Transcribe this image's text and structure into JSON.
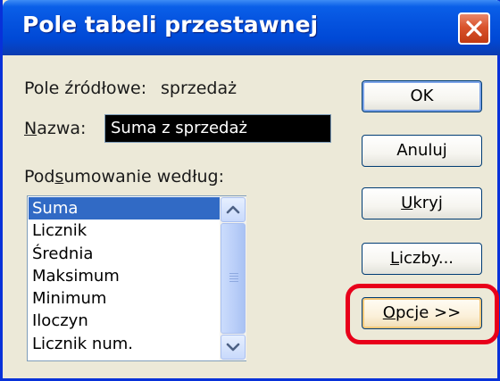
{
  "dialog": {
    "title": "Pole tabeli przestawnej"
  },
  "source_field": {
    "label": "Pole źródłowe:",
    "value": "sprzedaż"
  },
  "name_field": {
    "label_underlined": "N",
    "label_rest": "azwa:",
    "value": "Suma z sprzedaż"
  },
  "summarize": {
    "label_before": "Pod",
    "label_underlined": "s",
    "label_after": "umowanie według:",
    "items": [
      "Suma",
      "Licznik",
      "Średnia",
      "Maksimum",
      "Minimum",
      "Iloczyn",
      "Licznik num."
    ],
    "selected": "Suma"
  },
  "buttons": {
    "ok": "OK",
    "cancel": "Anuluj",
    "hide_underlined": "U",
    "hide_rest": "kryj",
    "numbers_underlined": "L",
    "numbers_rest": "iczby...",
    "options_underlined": "O",
    "options_rest": "pcje >>"
  },
  "icons": {
    "close": "close-icon",
    "scroll_up": "chevron-up-icon",
    "scroll_down": "chevron-down-icon"
  },
  "colors": {
    "titlebar": "#0553df",
    "selection": "#316ac5",
    "highlight_ring": "#e8001a",
    "close_button": "#d9532c"
  }
}
